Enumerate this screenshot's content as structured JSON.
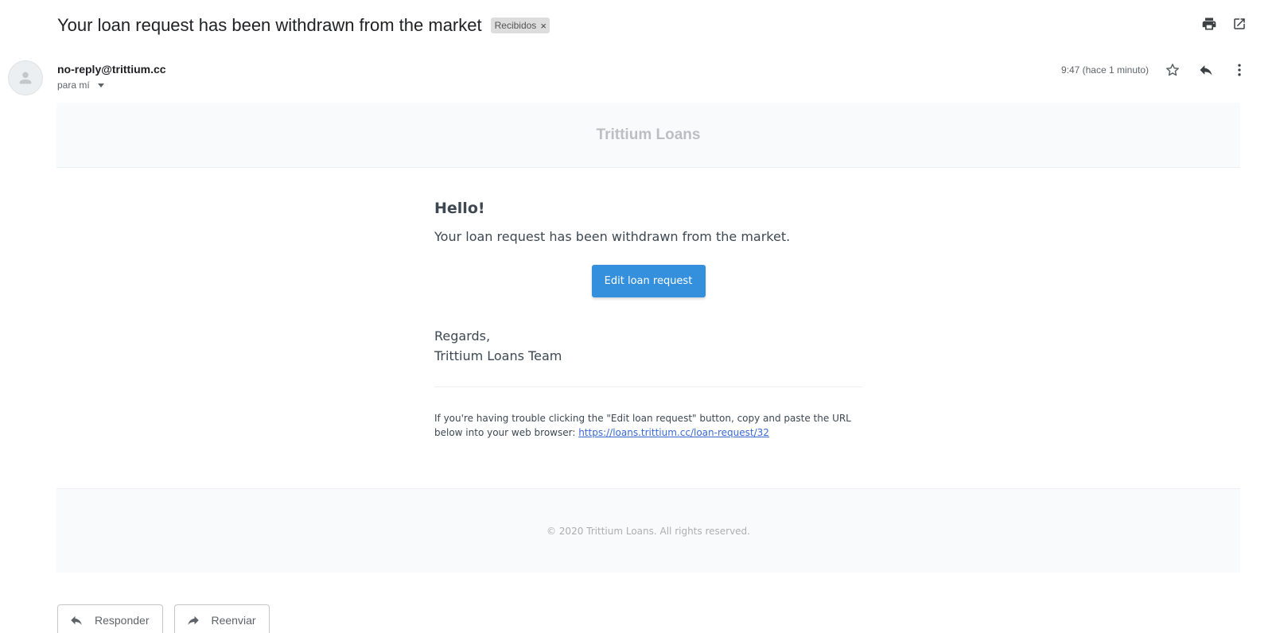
{
  "subject": "Your loan request has been withdrawn from the market",
  "label": {
    "text": "Recibidos",
    "remove": "×"
  },
  "top_icons": [
    "print-icon",
    "open-in-new-window-icon"
  ],
  "sender": {
    "email": "no-reply@trittium.cc",
    "recipient": "para mí",
    "timestamp": "9:47 (hace 1 minuto)"
  },
  "message_actions": [
    "star-icon",
    "reply-icon",
    "more-options-icon"
  ],
  "email": {
    "brand": "Trittium Loans",
    "greeting": "Hello!",
    "message": "Your loan request has been withdrawn from the market.",
    "button_label": "Edit loan request",
    "regards_line1": "Regards,",
    "regards_line2": "Trittium Loans Team",
    "subcopy_text": "If you're having trouble clicking the \"Edit loan request\" button, copy and paste the URL below into your web browser: ",
    "subcopy_link": "https://loans.trittium.cc/loan-request/32",
    "footer": "© 2020 Trittium Loans. All rights reserved.",
    "accent_color": "#3490dc"
  },
  "reply_actions": {
    "reply": "Responder",
    "forward": "Reenviar"
  }
}
